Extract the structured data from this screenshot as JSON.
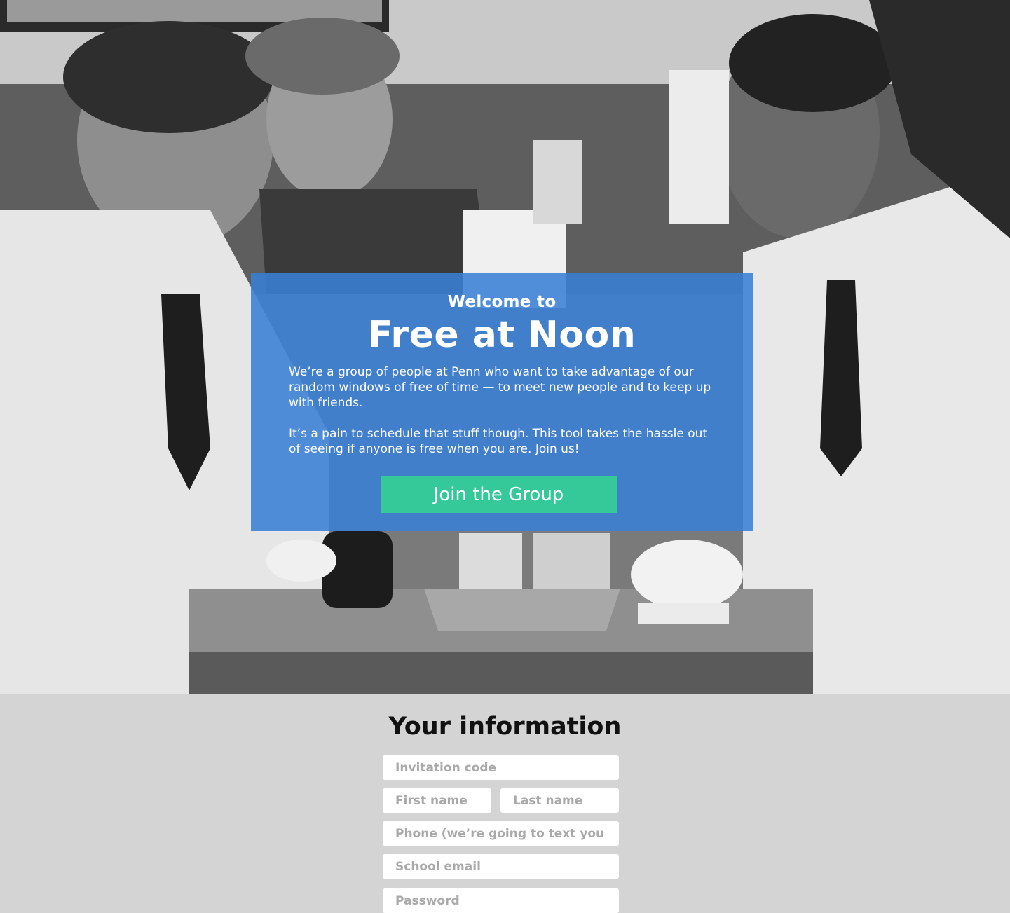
{
  "hero": {
    "image_description_icon": "photo-icon",
    "welcome": "Welcome to",
    "title": "Free at Noon",
    "paragraph_1": "We’re a group of people at Penn who want to take advantage of our random windows of free of time — to meet new people and to keep up with friends.",
    "paragraph_2": "It’s a pain to schedule that stuff though. This tool takes the hassle out of seeing if anyone is free when you are. Join us!",
    "button_label": "Join the Group"
  },
  "form": {
    "title": "Your information",
    "invitation_code": {
      "placeholder": "Invitation code",
      "value": ""
    },
    "first_name": {
      "placeholder": "First name",
      "value": ""
    },
    "last_name": {
      "placeholder": "Last name",
      "value": ""
    },
    "phone": {
      "placeholder": "Phone (we’re going to text you)",
      "value": ""
    },
    "school_email": {
      "placeholder": "School email",
      "value": ""
    },
    "password": {
      "placeholder": "Password",
      "value": ""
    }
  },
  "colors": {
    "card_blue": "#3a80d6",
    "button_green": "#35c99a",
    "form_background": "#d4d4d4"
  }
}
